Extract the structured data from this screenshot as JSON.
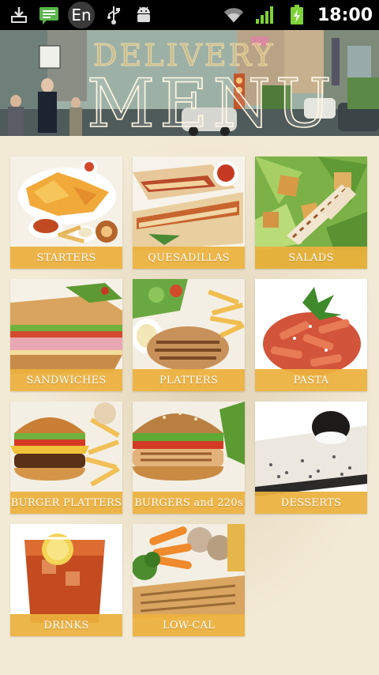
{
  "status_bar": {
    "time": "18:00",
    "input_language": "En",
    "icons": [
      "download-icon",
      "sms-icon",
      "usb-icon",
      "android-debug-icon",
      "wifi-icon",
      "signal-icon",
      "battery-charging-icon"
    ]
  },
  "banner": {
    "title_line1": "DELIVERY",
    "title_line2": "MENU"
  },
  "colors": {
    "tile_label_bg": "#ecb03c",
    "page_bg": "#f3ead6",
    "status_bar_bg": "#000000"
  },
  "menu": {
    "categories": [
      {
        "label": "STARTERS",
        "icon": "starters-photo"
      },
      {
        "label": "QUESADILLAS",
        "icon": "quesadillas-photo"
      },
      {
        "label": "SALADS",
        "icon": "salads-photo"
      },
      {
        "label": "SANDWICHES",
        "icon": "sandwiches-photo"
      },
      {
        "label": "PLATTERS",
        "icon": "platters-photo"
      },
      {
        "label": "PASTA",
        "icon": "pasta-photo"
      },
      {
        "label": "BURGER PLATTERS",
        "icon": "burger-platters-photo"
      },
      {
        "label": "BURGERS and 220s",
        "icon": "burgers-photo"
      },
      {
        "label": "DESSERTS",
        "icon": "desserts-photo"
      },
      {
        "label": "DRINKS",
        "icon": "drinks-photo"
      },
      {
        "label": "LOW-CAL",
        "icon": "low-cal-photo"
      }
    ]
  }
}
